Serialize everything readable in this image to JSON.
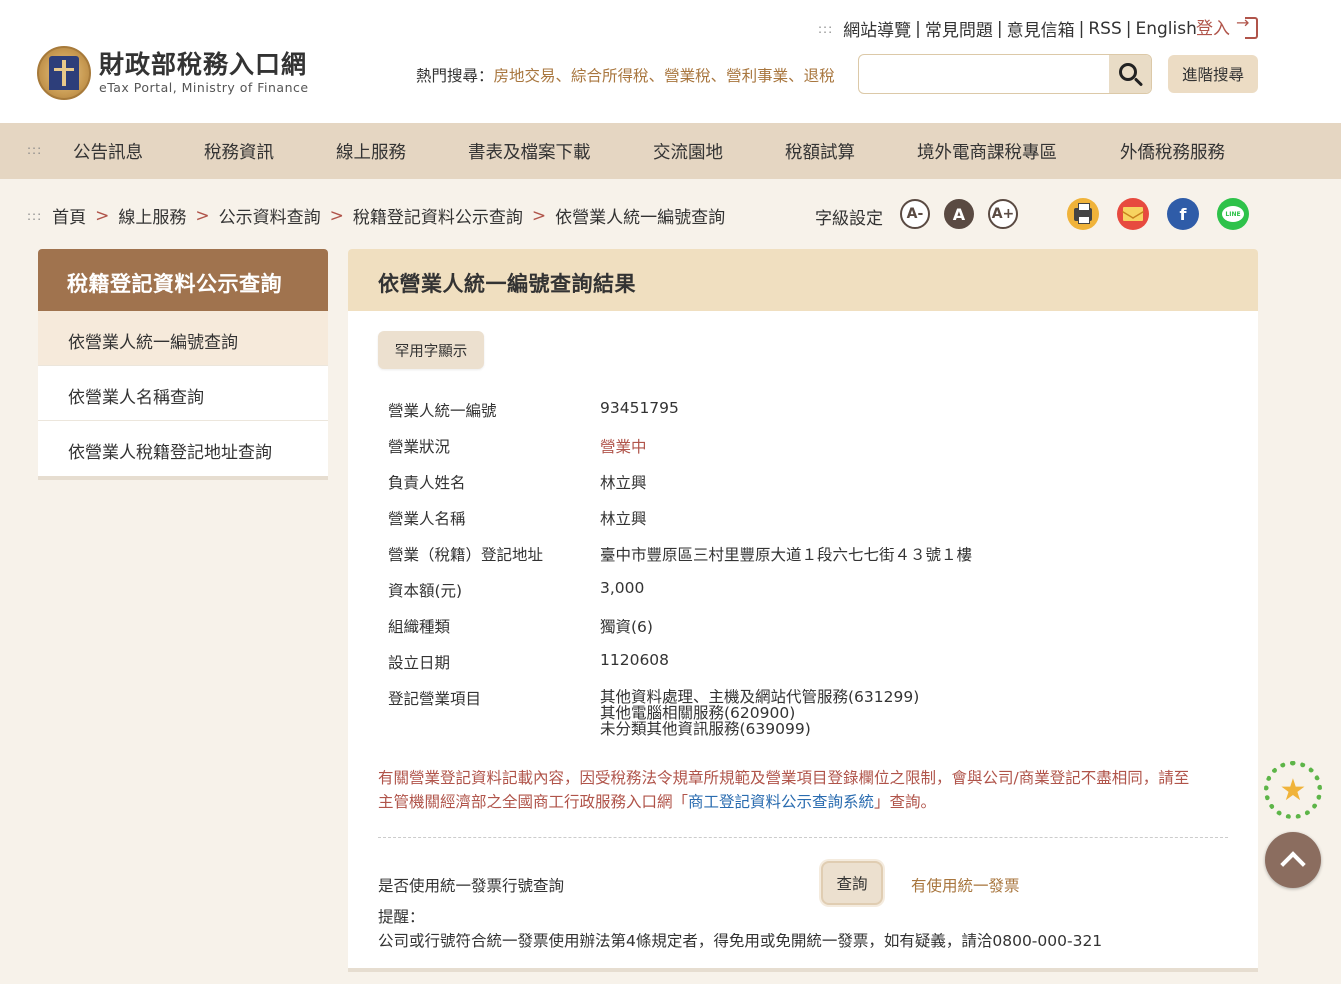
{
  "header": {
    "logo_title": "財政部稅務入口網",
    "logo_sub": "eTax Portal, Ministry of Finance",
    "top_links": [
      "網站導覽",
      "常見問題",
      "意見信箱",
      "RSS",
      "English"
    ],
    "login_label": "登入",
    "hot_label": "熱門搜尋：",
    "hot_keywords": [
      "房地交易",
      "綜合所得稅",
      "營業稅",
      "營利事業",
      "退稅"
    ],
    "search_placeholder": "",
    "advanced_label": "進階搜尋"
  },
  "nav": {
    "items": [
      "公告訊息",
      "稅務資訊",
      "線上服務",
      "書表及檔案下載",
      "交流園地",
      "稅額試算",
      "境外電商課稅專區",
      "外僑稅務服務"
    ]
  },
  "breadcrumb": {
    "items": [
      "首頁",
      "線上服務",
      "公示資料查詢",
      "稅籍登記資料公示查詢",
      "依營業人統一編號查詢"
    ],
    "separator": ">"
  },
  "font_setting": {
    "label": "字級設定",
    "small": "A-",
    "normal": "A",
    "large": "A+"
  },
  "sidebar": {
    "title": "稅籍登記資料公示查詢",
    "items": [
      "依營業人統一編號查詢",
      "依營業人名稱查詢",
      "依營業人稅籍登記地址查詢"
    ]
  },
  "main": {
    "title": "依營業人統一編號查詢結果",
    "rare_button": "罕用字顯示",
    "rows": [
      {
        "label": "營業人統一編號",
        "value": "93451795"
      },
      {
        "label": "營業狀況",
        "value": "營業中"
      },
      {
        "label": "負責人姓名",
        "value": "林立興"
      },
      {
        "label": "營業人名稱",
        "value": "林立興"
      },
      {
        "label": "營業（稅籍）登記地址",
        "value": "臺中市豐原區三村里豐原大道１段六七七街４３號１樓"
      },
      {
        "label": "資本額(元)",
        "value": "3,000"
      },
      {
        "label": "組織種類",
        "value": "獨資(6)"
      },
      {
        "label": "設立日期",
        "value": "1120608"
      }
    ],
    "business_label": "登記營業項目",
    "business_items": [
      "其他資料處理、主機及網站代管服務(631299)",
      "其他電腦相關服務(620900)",
      "未分類其他資訊服務(639099)"
    ],
    "notice_line1": "有關營業登記資料記載內容，因受稅務法令規章所規範及營業項目登錄欄位之限制，會與公司/商業登記不盡相同，請至",
    "notice_line2_pre": "主管機關經濟部之全國商工行政服務入口網「",
    "notice_link": "商工登記資料公示查詢系統",
    "notice_line2_post": "」查詢。",
    "invoice_query_label": "是否使用統一發票行號查詢",
    "query_button": "查詢",
    "query_result": "有使用統一發票",
    "remind_label": "提醒：",
    "remind_text": "公司或行號符合統一發票使用辦法第4條規定者，得免用或免開統一發票，如有疑義，請洽0800-000-321"
  },
  "colors": {
    "accent_brown": "#a0734e",
    "status_red": "#b0544a",
    "nav_bg": "#e5d6c2",
    "link_blue": "#2a6cb0"
  }
}
